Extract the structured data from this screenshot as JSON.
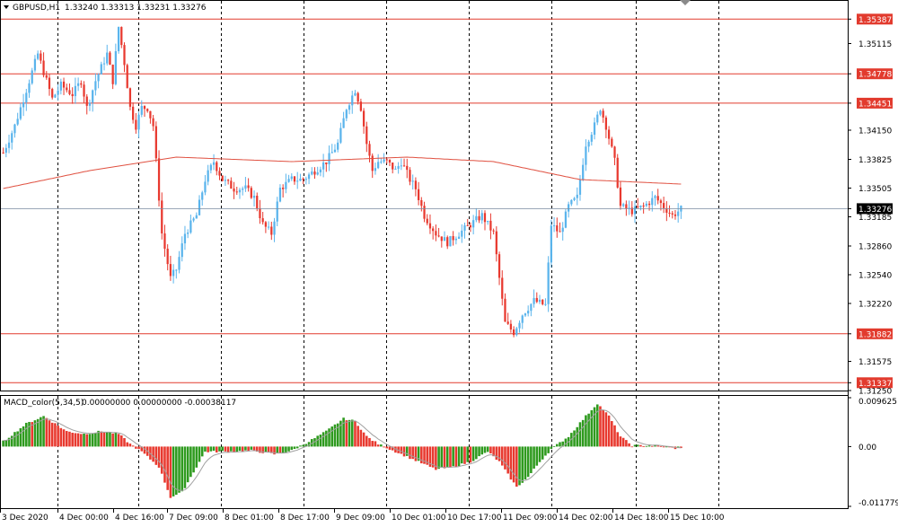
{
  "chart_header": {
    "symbol_label": "GBPUSD,H1",
    "ohlc": "1.33240 1.33313 1.33231 1.33276"
  },
  "macd_header": {
    "label": "MACD_color(5,34,5)",
    "values": "0.00000000 0.00000000 -0.00038117"
  },
  "price_axis": {
    "labels": [
      "1.35387",
      "1.35115",
      "1.34778",
      "1.34451",
      "1.34150",
      "1.33825",
      "1.33505",
      "1.33276",
      "1.33185",
      "1.32860",
      "1.32540",
      "1.32220",
      "1.31882",
      "1.31575",
      "1.31337",
      "1.31250"
    ],
    "highlight_red": [
      "1.35387",
      "1.34778",
      "1.34451",
      "1.31882",
      "1.31337"
    ],
    "current": "1.33276"
  },
  "macd_axis": {
    "labels": [
      "0.0096251",
      "0.00",
      "-0.0117794"
    ]
  },
  "time_axis": {
    "labels": [
      "3 Dec 2020",
      "4 Dec 00:00",
      "4 Dec 16:00",
      "7 Dec 09:00",
      "8 Dec 01:00",
      "8 Dec 17:00",
      "9 Dec 09:00",
      "10 Dec 01:00",
      "10 Dec 17:00",
      "11 Dec 09:00",
      "14 Dec 02:00",
      "14 Dec 18:00",
      "15 Dec 10:00"
    ]
  },
  "colors": {
    "bull": "#5AB4EC",
    "bear": "#E8392F",
    "level_line": "#E23B2E",
    "ma_line": "#E05040",
    "macd_up": "#2E9A1E",
    "macd_down": "#E8392F",
    "signal": "#A0A0A0"
  },
  "chart_data": {
    "type": "candlestick",
    "symbol": "GBPUSD",
    "timeframe": "H1",
    "ylim": [
      1.3125,
      1.3558
    ],
    "horizontal_levels": [
      1.35387,
      1.34778,
      1.34451,
      1.31882,
      1.31337
    ],
    "current_price": 1.33276,
    "close_path": [
      [
        0,
        1.339
      ],
      [
        4,
        1.342
      ],
      [
        8,
        1.346
      ],
      [
        12,
        1.35
      ],
      [
        14,
        1.348
      ],
      [
        17,
        1.345
      ],
      [
        20,
        1.3465
      ],
      [
        24,
        1.3455
      ],
      [
        27,
        1.347
      ],
      [
        29,
        1.344
      ],
      [
        32,
        1.347
      ],
      [
        36,
        1.35
      ],
      [
        38,
        1.347
      ],
      [
        40,
        1.353
      ],
      [
        42,
        1.349
      ],
      [
        44,
        1.344
      ],
      [
        46,
        1.342
      ],
      [
        48,
        1.344
      ],
      [
        50,
        1.344
      ],
      [
        52,
        1.342
      ],
      [
        55,
        1.33
      ],
      [
        58,
        1.325
      ],
      [
        60,
        1.326
      ],
      [
        63,
        1.33
      ],
      [
        67,
        1.332
      ],
      [
        70,
        1.336
      ],
      [
        73,
        1.338
      ],
      [
        76,
        1.336
      ],
      [
        80,
        1.335
      ],
      [
        84,
        1.335
      ],
      [
        87,
        1.334
      ],
      [
        90,
        1.331
      ],
      [
        93,
        1.33
      ],
      [
        96,
        1.335
      ],
      [
        100,
        1.336
      ],
      [
        104,
        1.336
      ],
      [
        108,
        1.337
      ],
      [
        112,
        1.338
      ],
      [
        116,
        1.34
      ],
      [
        119,
        1.344
      ],
      [
        122,
        1.346
      ],
      [
        124,
        1.344
      ],
      [
        126,
        1.34
      ],
      [
        128,
        1.337
      ],
      [
        130,
        1.338
      ],
      [
        133,
        1.338
      ],
      [
        136,
        1.337
      ],
      [
        138,
        1.338
      ],
      [
        141,
        1.336
      ],
      [
        143,
        1.335
      ],
      [
        146,
        1.332
      ],
      [
        150,
        1.33
      ],
      [
        154,
        1.329
      ],
      [
        158,
        1.33
      ],
      [
        162,
        1.331
      ],
      [
        166,
        1.332
      ],
      [
        170,
        1.33
      ],
      [
        172,
        1.325
      ],
      [
        174,
        1.32
      ],
      [
        177,
        1.319
      ],
      [
        180,
        1.321
      ],
      [
        184,
        1.3225
      ],
      [
        188,
        1.322
      ],
      [
        190,
        1.331
      ],
      [
        193,
        1.33
      ],
      [
        196,
        1.333
      ],
      [
        199,
        1.334
      ],
      [
        202,
        1.34
      ],
      [
        205,
        1.342
      ],
      [
        207,
        1.344
      ],
      [
        209,
        1.342
      ],
      [
        212,
        1.338
      ],
      [
        214,
        1.333
      ],
      [
        218,
        1.3325
      ],
      [
        222,
        1.333
      ],
      [
        226,
        1.334
      ],
      [
        229,
        1.333
      ],
      [
        232,
        1.332
      ],
      [
        235,
        1.3327
      ]
    ],
    "moving_average": [
      [
        0,
        1.335
      ],
      [
        30,
        1.337
      ],
      [
        60,
        1.3385
      ],
      [
        100,
        1.338
      ],
      [
        140,
        1.3385
      ],
      [
        170,
        1.338
      ],
      [
        200,
        1.336
      ],
      [
        235,
        1.3355
      ]
    ],
    "macd": {
      "ylim": [
        -0.0117794,
        0.0096251
      ],
      "histogram_path": [
        [
          0,
          0.001
        ],
        [
          8,
          0.0045
        ],
        [
          14,
          0.006
        ],
        [
          18,
          0.0045
        ],
        [
          22,
          0.003
        ],
        [
          28,
          0.0025
        ],
        [
          34,
          0.003
        ],
        [
          40,
          0.0025
        ],
        [
          44,
          0.0005
        ],
        [
          48,
          -0.001
        ],
        [
          54,
          -0.004
        ],
        [
          58,
          -0.01
        ],
        [
          62,
          -0.009
        ],
        [
          66,
          -0.005
        ],
        [
          70,
          -0.001
        ],
        [
          78,
          -0.001
        ],
        [
          86,
          -0.0008
        ],
        [
          94,
          -0.0015
        ],
        [
          100,
          -0.0008
        ],
        [
          106,
          0.001
        ],
        [
          112,
          0.003
        ],
        [
          118,
          0.0055
        ],
        [
          122,
          0.005
        ],
        [
          126,
          0.002
        ],
        [
          130,
          0.0005
        ],
        [
          136,
          -0.001
        ],
        [
          144,
          -0.003
        ],
        [
          150,
          -0.0045
        ],
        [
          156,
          -0.004
        ],
        [
          162,
          -0.003
        ],
        [
          168,
          -0.001
        ],
        [
          172,
          -0.003
        ],
        [
          178,
          -0.008
        ],
        [
          182,
          -0.006
        ],
        [
          186,
          -0.003
        ],
        [
          190,
          -0.0005
        ],
        [
          196,
          0.002
        ],
        [
          202,
          0.006
        ],
        [
          206,
          0.0085
        ],
        [
          210,
          0.006
        ],
        [
          214,
          0.002
        ],
        [
          218,
          0.0002
        ],
        [
          226,
          0.0002
        ],
        [
          232,
          -0.0003
        ],
        [
          235,
          -0.0004
        ]
      ]
    }
  }
}
